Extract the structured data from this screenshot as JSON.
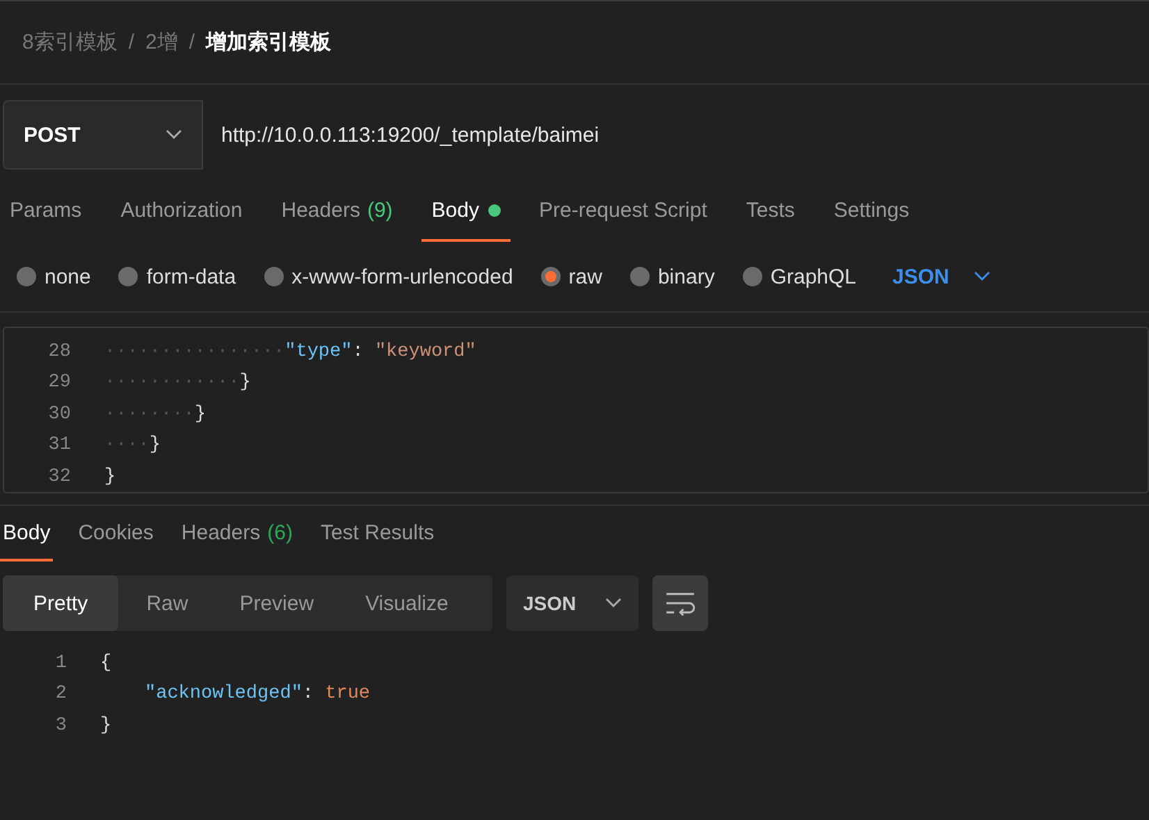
{
  "breadcrumb": [
    {
      "label": "8索引模板",
      "current": false
    },
    {
      "label": "2增",
      "current": false,
      "separator": "/"
    },
    {
      "label": "增加索引模板",
      "current": true,
      "separator": "/"
    }
  ],
  "request": {
    "method": "POST",
    "url": "http://10.0.0.113:19200/_template/baimei"
  },
  "request_tabs": [
    {
      "label": "Params",
      "selected": false
    },
    {
      "label": "Authorization",
      "selected": false
    },
    {
      "label": "Headers",
      "count": "(9)",
      "selected": false
    },
    {
      "label": "Body",
      "dot": true,
      "selected": true
    },
    {
      "label": "Pre-request Script",
      "selected": false
    },
    {
      "label": "Tests",
      "selected": false
    },
    {
      "label": "Settings",
      "selected": false
    }
  ],
  "body_types": [
    {
      "label": "none",
      "selected": false
    },
    {
      "label": "form-data",
      "selected": false
    },
    {
      "label": "x-www-form-urlencoded",
      "selected": false
    },
    {
      "label": "raw",
      "selected": true
    },
    {
      "label": "binary",
      "selected": false
    },
    {
      "label": "GraphQL",
      "selected": false
    }
  ],
  "body_format": "JSON",
  "request_body": [
    {
      "number": "28",
      "tokens": [
        {
          "kind": "indent",
          "text": "················"
        },
        {
          "kind": "key",
          "text": "\"type\""
        },
        {
          "kind": "punct",
          "text": ": "
        },
        {
          "kind": "string",
          "text": "\"keyword\""
        }
      ]
    },
    {
      "number": "29",
      "tokens": [
        {
          "kind": "indent",
          "text": "············"
        },
        {
          "kind": "punct",
          "text": "}"
        }
      ]
    },
    {
      "number": "30",
      "tokens": [
        {
          "kind": "indent",
          "text": "········"
        },
        {
          "kind": "punct",
          "text": "}"
        }
      ]
    },
    {
      "number": "31",
      "tokens": [
        {
          "kind": "indent",
          "text": "····"
        },
        {
          "kind": "punct",
          "text": "}"
        }
      ]
    },
    {
      "number": "32",
      "tokens": [
        {
          "kind": "punct",
          "text": "}"
        }
      ]
    }
  ],
  "response_tabs": [
    {
      "label": "Body",
      "selected": true
    },
    {
      "label": "Cookies",
      "selected": false
    },
    {
      "label": "Headers",
      "count": "(6)",
      "selected": false
    },
    {
      "label": "Test Results",
      "selected": false
    }
  ],
  "view_modes": [
    {
      "label": "Pretty",
      "selected": true
    },
    {
      "label": "Raw",
      "selected": false
    },
    {
      "label": "Preview",
      "selected": false
    },
    {
      "label": "Visualize",
      "selected": false
    }
  ],
  "response_format": "JSON",
  "response_body": [
    {
      "number": "1",
      "indented": false,
      "tokens": [
        {
          "kind": "punct",
          "text": "{"
        }
      ]
    },
    {
      "number": "2",
      "indented": true,
      "tokens": [
        {
          "kind": "key",
          "text": "\"acknowledged\""
        },
        {
          "kind": "punct",
          "text": ": "
        },
        {
          "kind": "literal",
          "text": "true"
        }
      ]
    },
    {
      "number": "3",
      "indented": false,
      "tokens": [
        {
          "kind": "punct",
          "text": "}"
        }
      ]
    }
  ]
}
